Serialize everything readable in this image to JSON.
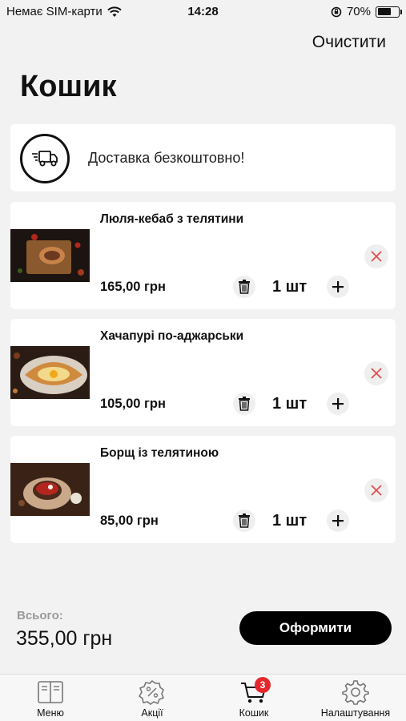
{
  "status_bar": {
    "carrier": "Немає SIM-карти",
    "time": "14:28",
    "battery_percent": "70%",
    "battery_level": 0.7
  },
  "header": {
    "clear_label": "Очистити",
    "title": "Кошик"
  },
  "delivery": {
    "text": "Доставка безкоштовно!",
    "icon": "delivery-truck-icon"
  },
  "cart_items": [
    {
      "name": "Люля-кебаб з телятини",
      "price": "165,00 грн",
      "quantity": "1 шт",
      "image": "kebab-plate"
    },
    {
      "name": "Хачапурі по-аджарськи",
      "price": "105,00 грн",
      "quantity": "1 шт",
      "image": "khachapuri-plate"
    },
    {
      "name": "Борщ із телятиною",
      "price": "85,00 грн",
      "quantity": "1 шт",
      "image": "borscht-bowl"
    }
  ],
  "summary": {
    "total_label": "Всього:",
    "total_value": "355,00 грн",
    "checkout_label": "Оформити"
  },
  "tabs": [
    {
      "label": "Меню",
      "icon": "menu-book-icon"
    },
    {
      "label": "Акції",
      "icon": "discount-icon"
    },
    {
      "label": "Кошик",
      "icon": "cart-icon",
      "badge": "3",
      "active": true
    },
    {
      "label": "Налаштування",
      "icon": "gear-icon"
    }
  ],
  "colors": {
    "accent_remove": "#e34d4d",
    "badge": "#e5282c",
    "button": "#000000"
  }
}
